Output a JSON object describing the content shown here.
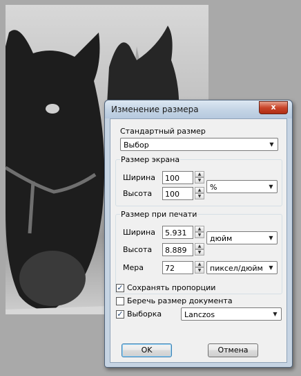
{
  "dialog": {
    "title": "Изменение размера",
    "close_label": "x",
    "standard_size": {
      "title": "Стандартный размер",
      "selected": "Выбор"
    },
    "screen_size": {
      "title": "Размер экрана",
      "width_label": "Ширина",
      "width_value": "100",
      "height_label": "Высота",
      "height_value": "100",
      "unit": "%"
    },
    "print_size": {
      "title": "Размер при печати",
      "width_label": "Ширина",
      "width_value": "5.931",
      "height_label": "Высота",
      "height_value": "8.889",
      "unit": "дюйм",
      "resolution_label": "Мера",
      "resolution_value": "72",
      "resolution_unit": "пиксел/дюйм"
    },
    "options": {
      "keep_proportions": {
        "label": "Сохранять пропорции",
        "checked": true
      },
      "keep_doc_size": {
        "label": "Беречь размер документа",
        "checked": false
      },
      "resample": {
        "label": "Выборка",
        "checked": true,
        "method": "Lanczos"
      }
    },
    "ok_label": "OK",
    "cancel_label": "Отмена"
  },
  "icons": {
    "check": "✓",
    "down": "▼",
    "up": "▲"
  }
}
